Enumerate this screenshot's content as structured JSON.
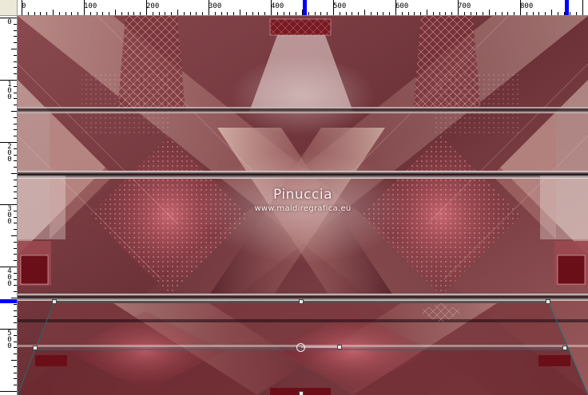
{
  "ruler": {
    "horizontal_labels": [
      "0",
      "100",
      "200",
      "300",
      "400",
      "500",
      "600",
      "700",
      "800"
    ],
    "vertical_labels": [
      "0",
      "1\n0\n0",
      "2\n0\n0",
      "3\n0\n0",
      "4\n0\n0",
      "5\n0\n0"
    ]
  },
  "canvas": {
    "watermark_name": "Pinuccia",
    "watermark_url": "www.maidiregrafica.eu"
  },
  "colors": {
    "ruler_marker": "#0000ff",
    "dark_wine": "#5a1e26",
    "mid_rose": "#b0565f",
    "light_beige": "#e5c5b8",
    "handle_line": "#1f6e6e"
  },
  "icons": {
    "rotation_handle": "rotation-pivot-icon"
  }
}
